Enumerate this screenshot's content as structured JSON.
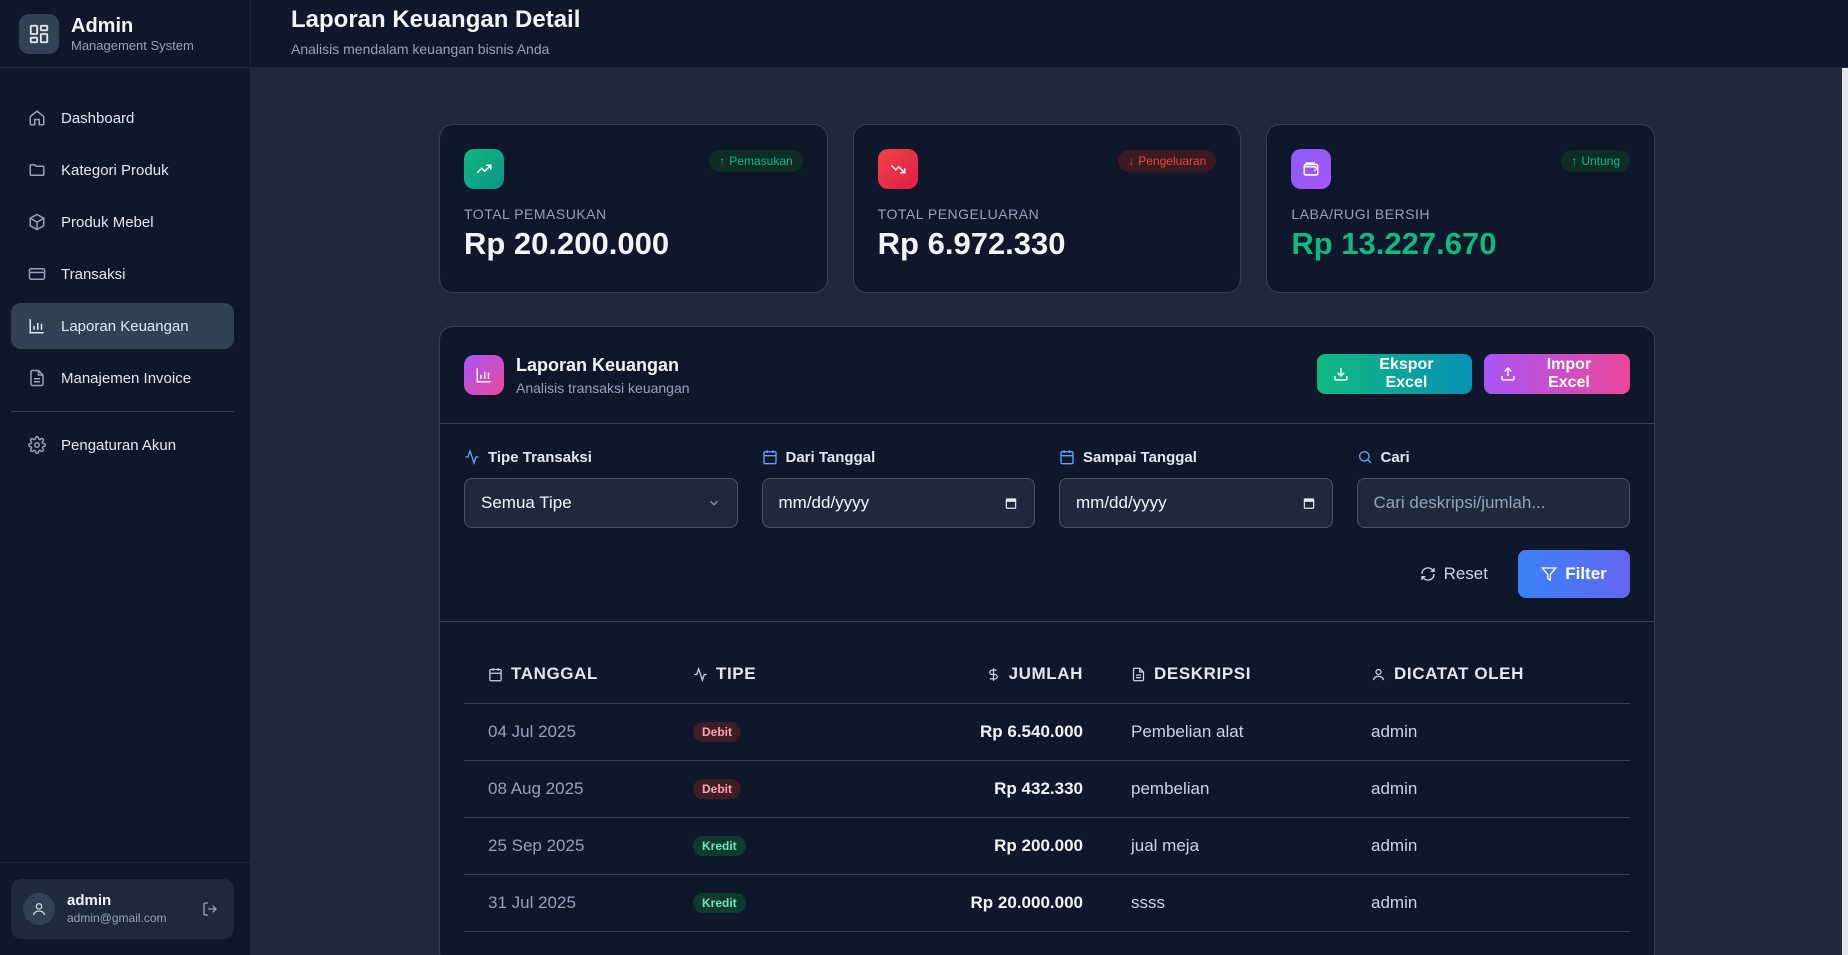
{
  "brand": {
    "title": "Admin",
    "subtitle": "Management System"
  },
  "header": {
    "title": "Laporan Keuangan Detail",
    "subtitle": "Analisis mendalam keuangan bisnis Anda"
  },
  "sidebar": {
    "items": [
      {
        "label": "Dashboard",
        "icon": "home-icon"
      },
      {
        "label": "Kategori Produk",
        "icon": "folder-icon"
      },
      {
        "label": "Produk Mebel",
        "icon": "box-icon"
      },
      {
        "label": "Transaksi",
        "icon": "credit-card-icon"
      },
      {
        "label": "Laporan Keuangan",
        "icon": "bar-chart-icon",
        "active": true
      },
      {
        "label": "Manajemen Invoice",
        "icon": "document-icon"
      },
      {
        "label": "Pengaturan Akun",
        "icon": "gear-icon"
      }
    ]
  },
  "user": {
    "name": "admin",
    "email": "admin@gmail.com"
  },
  "stats": [
    {
      "label": "TOTAL PEMASUKAN",
      "value": "Rp 20.200.000",
      "badge": "Pemasukan",
      "badge_arrow": "↑",
      "color": "#10b981"
    },
    {
      "label": "TOTAL PENGELUARAN",
      "value": "Rp 6.972.330",
      "badge": "Pengeluaran",
      "badge_arrow": "↓",
      "color": "#ef4444"
    },
    {
      "label": "LABA/RUGI BERSIH",
      "value": "Rp 13.227.670",
      "badge": "Untung",
      "badge_arrow": "↑",
      "color": "#8b5cf6"
    }
  ],
  "panel": {
    "title": "Laporan Keuangan",
    "subtitle": "Analisis transaksi keuangan",
    "export_label": "Ekspor Excel",
    "import_label": "Impor Excel"
  },
  "filters": {
    "type_label": "Tipe Transaksi",
    "type_value": "Semua Tipe",
    "from_label": "Dari Tanggal",
    "from_value": "mm/dd/yyyy",
    "to_label": "Sampai Tanggal",
    "to_value": "mm/dd/yyyy",
    "search_label": "Cari",
    "search_placeholder": "Cari deskripsi/jumlah...",
    "reset_label": "Reset",
    "filter_label": "Filter"
  },
  "table": {
    "headers": {
      "date": "TANGGAL",
      "type": "TIPE",
      "amount": "JUMLAH",
      "desc": "DESKRIPSI",
      "by": "DICATAT OLEH"
    },
    "rows": [
      {
        "date": "04 Jul 2025",
        "type": "Debit",
        "amount": "Rp 6.540.000",
        "desc": "Pembelian alat",
        "by": "admin"
      },
      {
        "date": "08 Aug 2025",
        "type": "Debit",
        "amount": "Rp 432.330",
        "desc": "pembelian",
        "by": "admin"
      },
      {
        "date": "25 Sep 2025",
        "type": "Kredit",
        "amount": "Rp 200.000",
        "desc": "jual meja",
        "by": "admin"
      },
      {
        "date": "31 Jul 2025",
        "type": "Kredit",
        "amount": "Rp 20.000.000",
        "desc": "ssss",
        "by": "admin"
      }
    ]
  }
}
